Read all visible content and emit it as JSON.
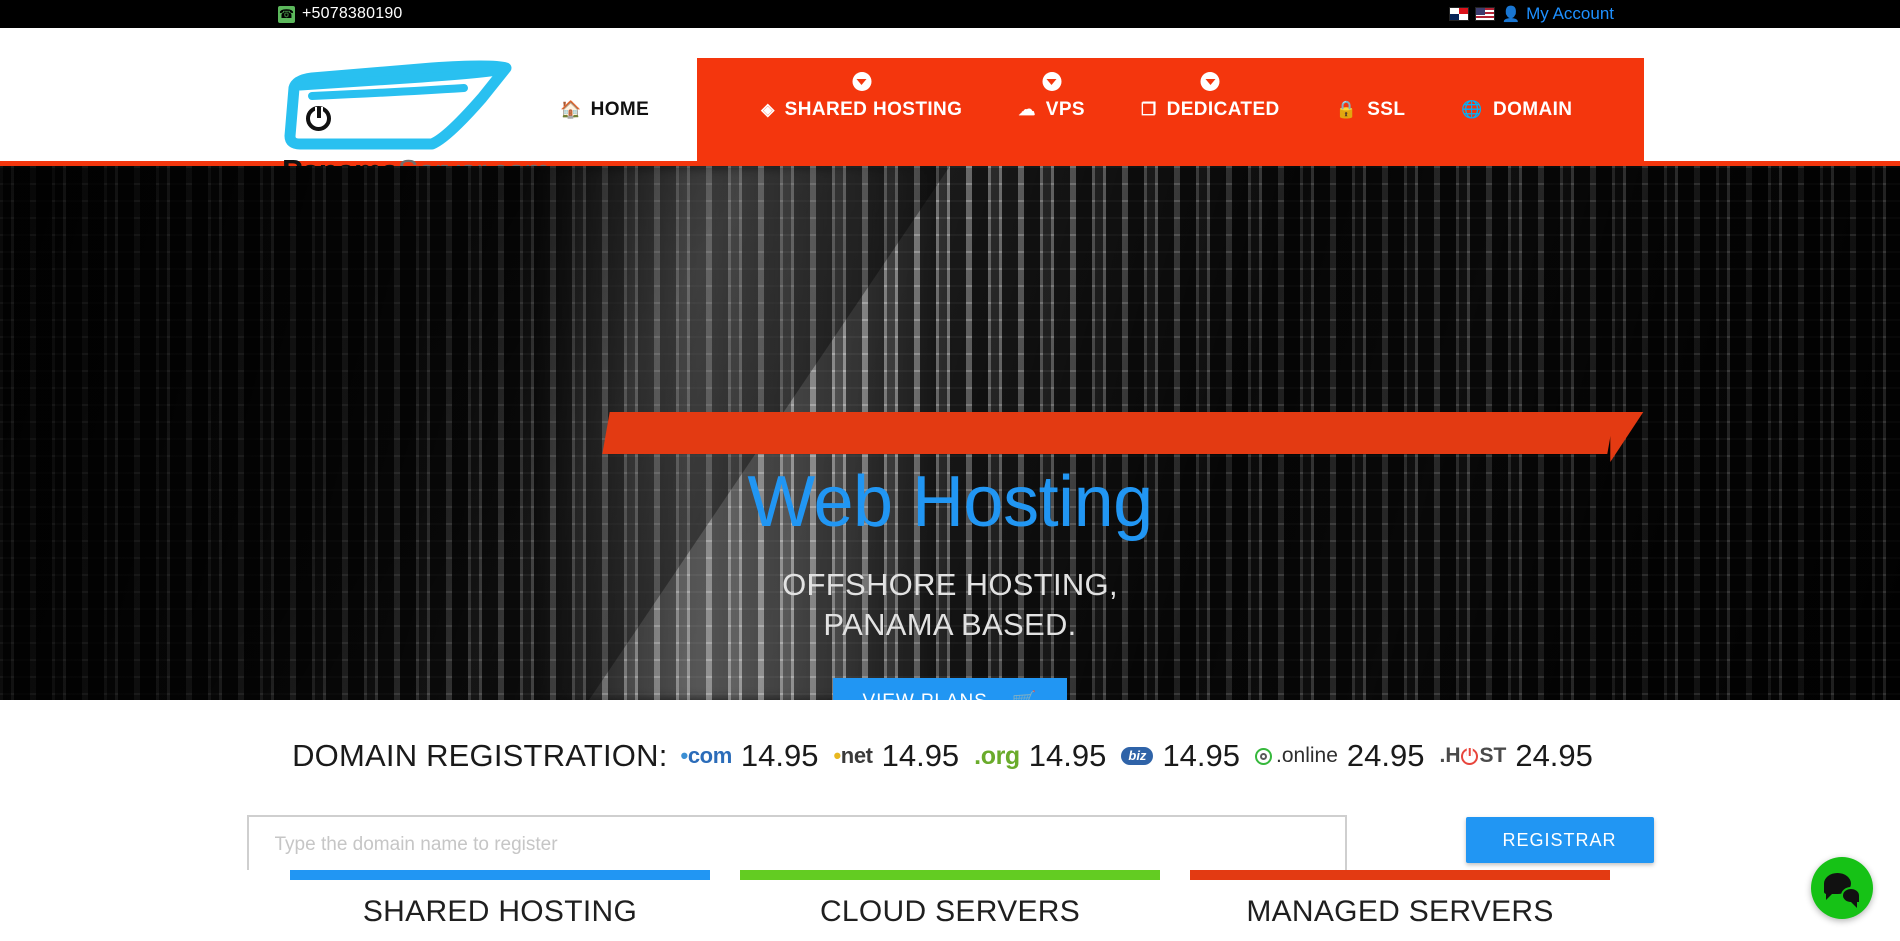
{
  "topbar": {
    "phone_icon": "phone-icon",
    "phone": "+5078380190",
    "flags": [
      {
        "name": "flag-panama",
        "label": "Panama"
      },
      {
        "name": "flag-usa",
        "label": "United States"
      }
    ],
    "account_icon": "user-icon",
    "account_label": "My Account"
  },
  "logo": {
    "brand_bold": "Panama",
    "brand_light": "Server.com",
    "mark_icon": "server-power-logo-icon"
  },
  "nav": {
    "home": {
      "label": "HOME",
      "icon": "home-icon",
      "active": true
    },
    "items": [
      {
        "label": "SHARED HOSTING",
        "icon": "cubes-icon",
        "dropdown": true
      },
      {
        "label": "VPS",
        "icon": "cloud-icon",
        "dropdown": true
      },
      {
        "label": "DEDICATED",
        "icon": "box-icon",
        "dropdown": true
      },
      {
        "label": "SSL",
        "icon": "lock-icon",
        "dropdown": false
      },
      {
        "label": "DOMAIN",
        "icon": "globe-icon",
        "dropdown": false
      }
    ]
  },
  "hero": {
    "title": "Web Hosting",
    "subtitle_line1": "OFFSHORE HOSTING,",
    "subtitle_line2": "PANAMA BASED.",
    "cta_label": "VIEW PLANS",
    "cta_icon": "shopping-cart-icon",
    "background": "datacenter-server-racks-grayscale"
  },
  "domain": {
    "heading": "DOMAIN REGISTRATION:",
    "tlds": [
      {
        "tld": ".com",
        "dot": ".",
        "name": "com",
        "price": "14.95",
        "color": "#2b6cb9"
      },
      {
        "tld": ".net",
        "dot": ".",
        "name": "net",
        "price": "14.95",
        "color": "#3a3a3a"
      },
      {
        "tld": ".org",
        "dot": ".",
        "name": "org",
        "price": "14.95",
        "color": "#6aab2b"
      },
      {
        "tld": ".biz",
        "dot": "",
        "name": "biz",
        "price": "14.95",
        "color": "#2f63a8"
      },
      {
        "tld": ".online",
        "dot": ".",
        "name": "online",
        "price": "24.95",
        "color": "#2e2e2e"
      },
      {
        "tld": ".HOST",
        "dot": ".",
        "name": "HOST",
        "price": "24.95",
        "color": "#4a4a4a"
      }
    ],
    "input_placeholder": "Type the domain name to register",
    "input_value": "",
    "button_label": "REGISTRAR"
  },
  "cards": [
    {
      "title": "SHARED HOSTING",
      "bar_color": "#2196F3"
    },
    {
      "title": "CLOUD SERVERS",
      "bar_color": "#63CC22"
    },
    {
      "title": "MANAGED SERVERS",
      "bar_color": "#E33A12"
    }
  ],
  "chat": {
    "icon": "chat-bubbles-icon",
    "color": "#16c216"
  },
  "theme": {
    "brand_red": "#F4360D",
    "brand_blue": "#2196F3",
    "brand_green": "#63CC22",
    "logo_cyan": "#29C0F0"
  }
}
